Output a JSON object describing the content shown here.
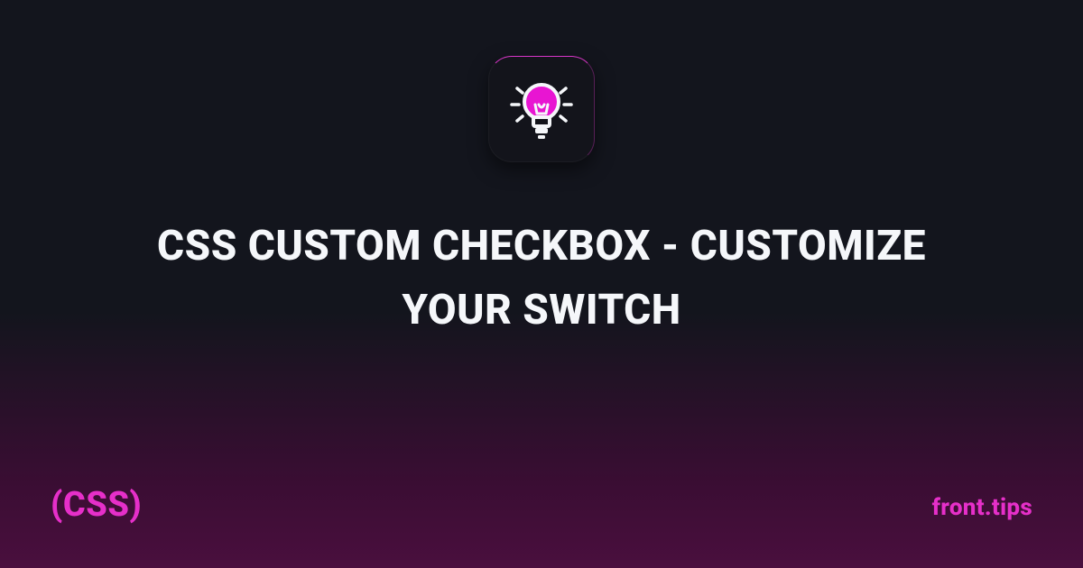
{
  "title": "CSS CUSTOM CHECKBOX - CUSTOMIZE YOUR SWITCH",
  "category": "(CSS)",
  "brand": "front.tips",
  "icon": "lightbulb-idea-icon",
  "colors": {
    "accent": "#e62fc9",
    "text": "#f5f7fa",
    "bg_top": "#13151d",
    "bg_bottom": "#4a0f3e"
  }
}
